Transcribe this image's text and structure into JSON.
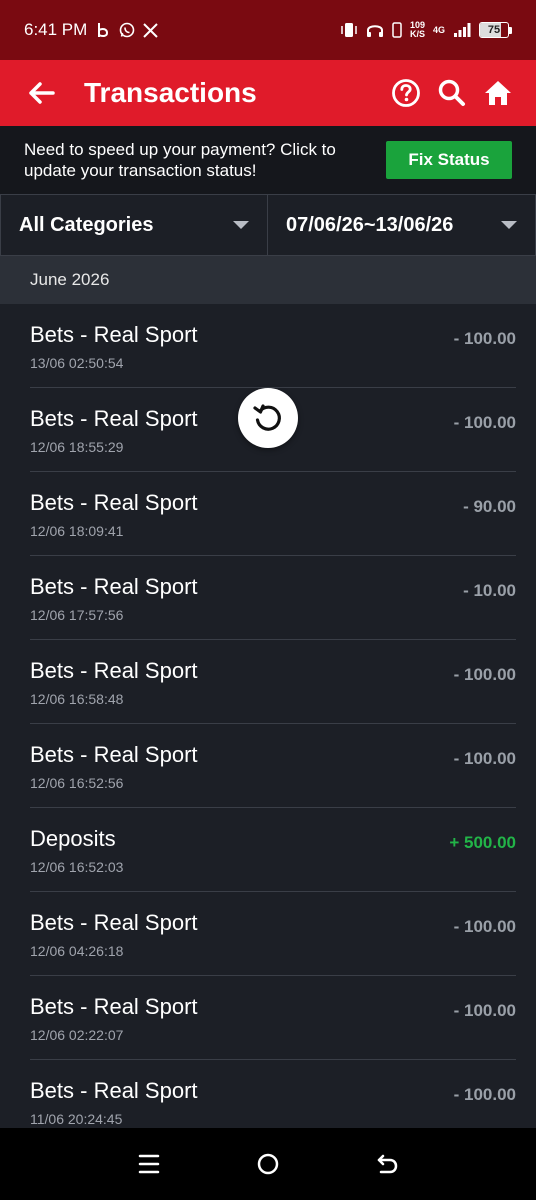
{
  "status_bar": {
    "time": "6:41 PM",
    "net_speed_value": "109",
    "net_speed_unit": "K/S",
    "net_type": "4G",
    "battery": "75",
    "battery_level": 0.75,
    "icons": [
      "b-app-icon",
      "whatsapp-icon",
      "x-icon",
      "vibrate-icon",
      "headphones-icon",
      "phone-icon",
      "signal-icon"
    ]
  },
  "header": {
    "title": "Transactions",
    "icons": [
      "back-arrow-icon",
      "help-icon",
      "search-icon",
      "home-icon"
    ]
  },
  "banner": {
    "text": "Need to speed up your payment? Click to update your transaction status!",
    "button_label": "Fix Status"
  },
  "filters": {
    "category": "All Categories",
    "date_range": "07/06/26~13/06/26"
  },
  "month": "June 2026",
  "transactions": [
    {
      "title": "Bets - Real Sport",
      "time": "13/06 02:50:54",
      "amount": "- 100.00"
    },
    {
      "title": "Bets - Real Sport",
      "time": "12/06 18:55:29",
      "amount": "- 100.00"
    },
    {
      "title": "Bets - Real Sport",
      "time": "12/06 18:09:41",
      "amount": "- 90.00"
    },
    {
      "title": "Bets - Real Sport",
      "time": "12/06 17:57:56",
      "amount": "- 10.00"
    },
    {
      "title": "Bets - Real Sport",
      "time": "12/06 16:58:48",
      "amount": "- 100.00"
    },
    {
      "title": "Bets - Real Sport",
      "time": "12/06 16:52:56",
      "amount": "- 100.00"
    },
    {
      "title": "Deposits",
      "time": "12/06 16:52:03",
      "amount": "+ 500.00"
    },
    {
      "title": "Bets - Real Sport",
      "time": "12/06 04:26:18",
      "amount": "- 100.00"
    },
    {
      "title": "Bets - Real Sport",
      "time": "12/06 02:22:07",
      "amount": "- 100.00"
    },
    {
      "title": "Bets - Real Sport",
      "time": "11/06 20:24:45",
      "amount": "- 100.00"
    }
  ],
  "colors": {
    "status_bar": "#7a0a11",
    "header": "#e01b2a",
    "fix_button": "#1aa33c",
    "positive_amount": "#22b448",
    "negative_amount": "#9aa0a8",
    "background": "#1c1f26"
  },
  "nav_icons": [
    "menu-icon",
    "home-circle-icon",
    "back-icon"
  ]
}
